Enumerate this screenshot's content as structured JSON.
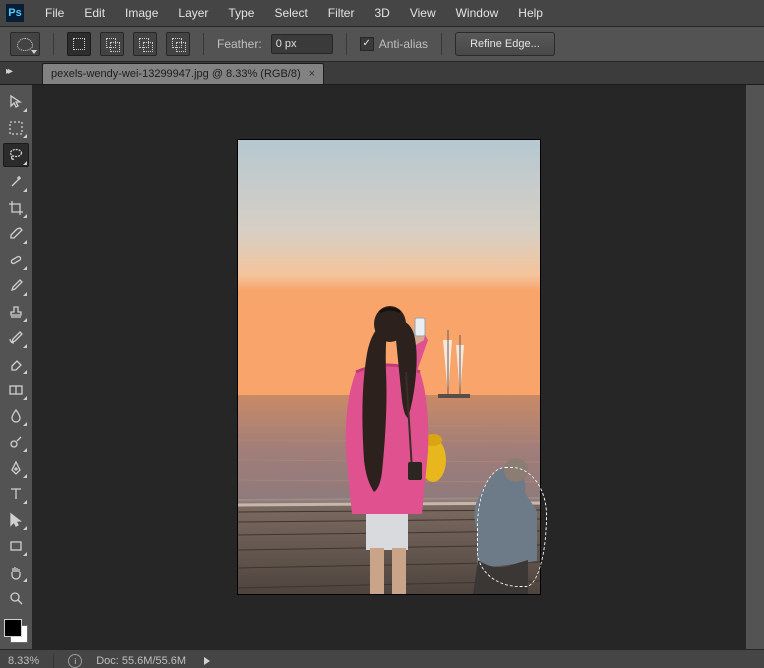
{
  "menu": [
    "File",
    "Edit",
    "Image",
    "Layer",
    "Type",
    "Select",
    "Filter",
    "3D",
    "View",
    "Window",
    "Help"
  ],
  "options": {
    "feather_label": "Feather:",
    "feather_value": "0 px",
    "antialias_label": "Anti-alias",
    "refine_label": "Refine Edge..."
  },
  "tab": {
    "title": "pexels-wendy-wei-13299947.jpg @ 8.33% (RGB/8)",
    "close": "×"
  },
  "status": {
    "zoom": "8.33%",
    "doc_label": "Doc:",
    "doc_value": "55.6M/55.6M"
  },
  "swatch": {
    "fg": "#000000",
    "bg": "#ffffff"
  },
  "tools_column": [
    "move",
    "marquee",
    "lasso",
    "magic-wand",
    "crop",
    "eyedropper",
    "healing-brush",
    "brush",
    "clone-stamp",
    "history-brush",
    "eraser",
    "gradient",
    "blur",
    "dodge",
    "pen",
    "type",
    "path-select",
    "rectangle",
    "hand",
    "zoom"
  ]
}
